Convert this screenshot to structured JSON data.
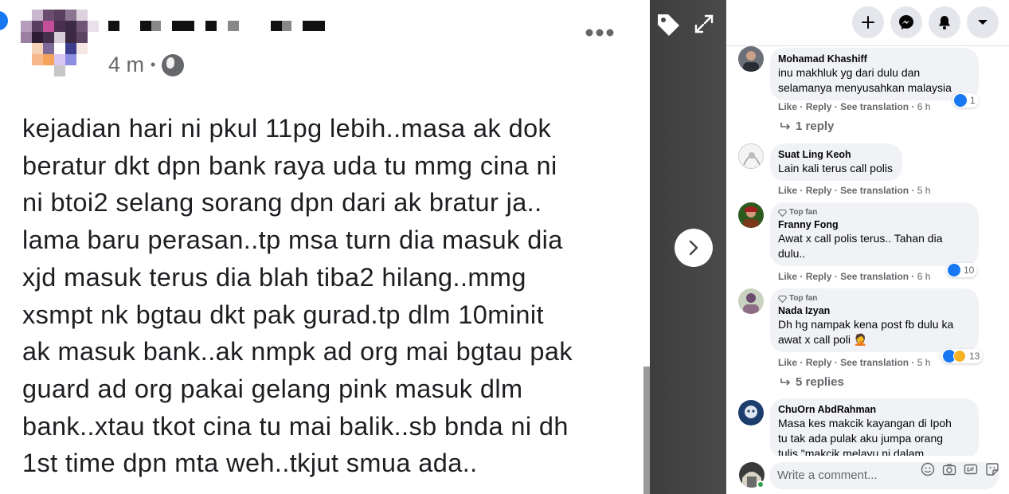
{
  "post": {
    "timestamp": "4 m",
    "separator": "•",
    "more_icon": "more-horizontal-icon",
    "text_lines": [
      "kejadian hari ni pkul 11pg lebih..masa ak dok",
      "beratur dkt dpn bank raya uda tu mmg  cina ni",
      "ni btoi2 selang sorang dpn dari ak bratur ja..",
      "lama baru perasan..tp msa turn dia masuk dia",
      "xjd masuk terus dia blah tiba2 hilang..mmg",
      "xsmpt nk bgtau dkt pak gurad.tp dlm 10minit",
      "ak masuk bank..ak nmpk ad org mai bgtau pak",
      "guard ad org pakai gelang pink masuk dlm",
      "bank..xtau tkot cina tu mai balik..sb bnda ni dh",
      "1st time dpn mta weh..tkjut smua ada.."
    ]
  },
  "viewer": {
    "tag_icon": "tag-icon",
    "expand_icon": "expand-icon",
    "next_icon": "chevron-right-icon"
  },
  "topbar": {
    "buttons": [
      "plus-icon",
      "messenger-icon",
      "notifications-icon",
      "caret-down-icon"
    ]
  },
  "comments": [
    {
      "name": "Mohamad Khashiff",
      "text": [
        "inu makhluk yg dari dulu dan",
        "selamanya menyusahkan malaysia"
      ],
      "like": "Like",
      "reply": "Reply",
      "translate": "See translation",
      "time": "6 h",
      "reaction_count": "1",
      "replies_label": "1 reply"
    },
    {
      "name": "Suat Ling Keoh",
      "text": [
        "Lain kali terus call polis"
      ],
      "like": "Like",
      "reply": "Reply",
      "translate": "See translation",
      "time": "5 h"
    },
    {
      "badge": "Top fan",
      "name": "Franny Fong",
      "text": [
        "Awat x call polis terus.. Tahan dia",
        "dulu.."
      ],
      "like": "Like",
      "reply": "Reply",
      "translate": "See translation",
      "time": "6 h",
      "reaction_count": "10"
    },
    {
      "badge": "Top fan",
      "name": "Nada Izyan",
      "text": [
        "Dh hg nampak kena post fb dulu ka",
        "awat x call poli 🤦"
      ],
      "like": "Like",
      "reply": "Reply",
      "translate": "See translation",
      "time": "5 h",
      "reaction_count": "13",
      "replies_label": "5 replies"
    },
    {
      "name": "ChuOrn AbdRahman",
      "text": [
        "Masa kes makcik kayangan di Ipoh",
        "tu tak ada pulak aku jumpa orang",
        "tulis \"makcik melayu ni dalam"
      ]
    }
  ],
  "separator_dot": "·",
  "composer": {
    "placeholder": "Write a comment...",
    "icons": [
      "emoji-icon",
      "camera-icon",
      "gif-icon",
      "sticker-icon"
    ]
  },
  "colors": {
    "facebook_blue": "#1877f2",
    "secondary_text": "#65676b",
    "bubble_bg": "#f0f2f5",
    "viewer_dark": "#444444"
  }
}
